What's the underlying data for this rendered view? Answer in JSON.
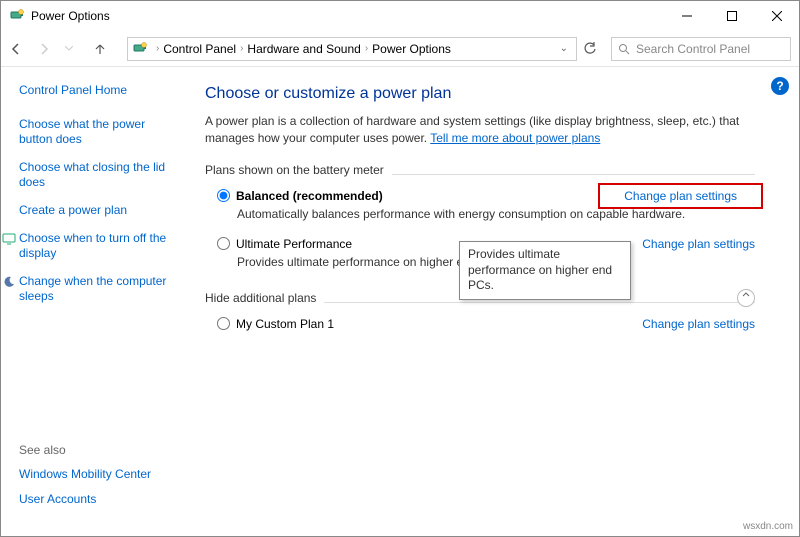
{
  "window": {
    "title": "Power Options"
  },
  "breadcrumb": {
    "items": [
      "Control Panel",
      "Hardware and Sound",
      "Power Options"
    ]
  },
  "search": {
    "placeholder": "Search Control Panel"
  },
  "sidebar": {
    "home": "Control Panel Home",
    "links": [
      "Choose what the power button does",
      "Choose what closing the lid does",
      "Create a power plan",
      "Choose when to turn off the display",
      "Change when the computer sleeps"
    ],
    "see_also_hd": "See also",
    "see_also": [
      "Windows Mobility Center",
      "User Accounts"
    ]
  },
  "main": {
    "heading": "Choose or customize a power plan",
    "desc_pre": "A power plan is a collection of hardware and system settings (like display brightness, sleep, etc.) that manages how your computer uses power. ",
    "desc_link": "Tell me more about power plans",
    "section1": "Plans shown on the battery meter",
    "section2": "Hide additional plans",
    "plans": [
      {
        "name": "Balanced (recommended)",
        "desc": "Automatically balances performance with energy consumption on capable hardware.",
        "link": "Change plan settings",
        "checked": true
      },
      {
        "name": "Ultimate Performance",
        "desc": "Provides ultimate performance on higher en",
        "link": "Change plan settings",
        "checked": false
      }
    ],
    "hidden_plan": {
      "name": "My Custom Plan 1",
      "link": "Change plan settings"
    },
    "tooltip": "Provides ultimate performance on higher end PCs."
  },
  "watermark": "wsxdn.com"
}
